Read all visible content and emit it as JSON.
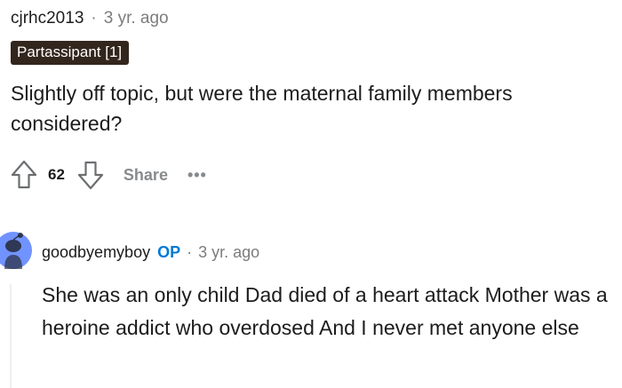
{
  "comment": {
    "username": "cjrhc2013",
    "separator": "·",
    "age": "3 yr. ago",
    "flair": "Partassipant [1]",
    "body": "Slightly off topic, but were the maternal family members considered?",
    "score": "62",
    "share_label": "Share",
    "more_label": "•••"
  },
  "reply": {
    "username": "goodbyemyboy",
    "op_badge": "OP",
    "separator": "·",
    "age": "3 yr. ago",
    "body": "She was an only child Dad died of a heart attack Mother was a heroine addict who overdosed And I never met anyone else"
  },
  "icons": {
    "upvote": "upvote-arrow-icon",
    "downvote": "downvote-arrow-icon",
    "avatar": "snoo-avatar-icon"
  },
  "colors": {
    "flair_bg": "#33261d",
    "op_blue": "#0079d3",
    "muted": "#878a8c",
    "avatar_blue": "#7193ff"
  }
}
